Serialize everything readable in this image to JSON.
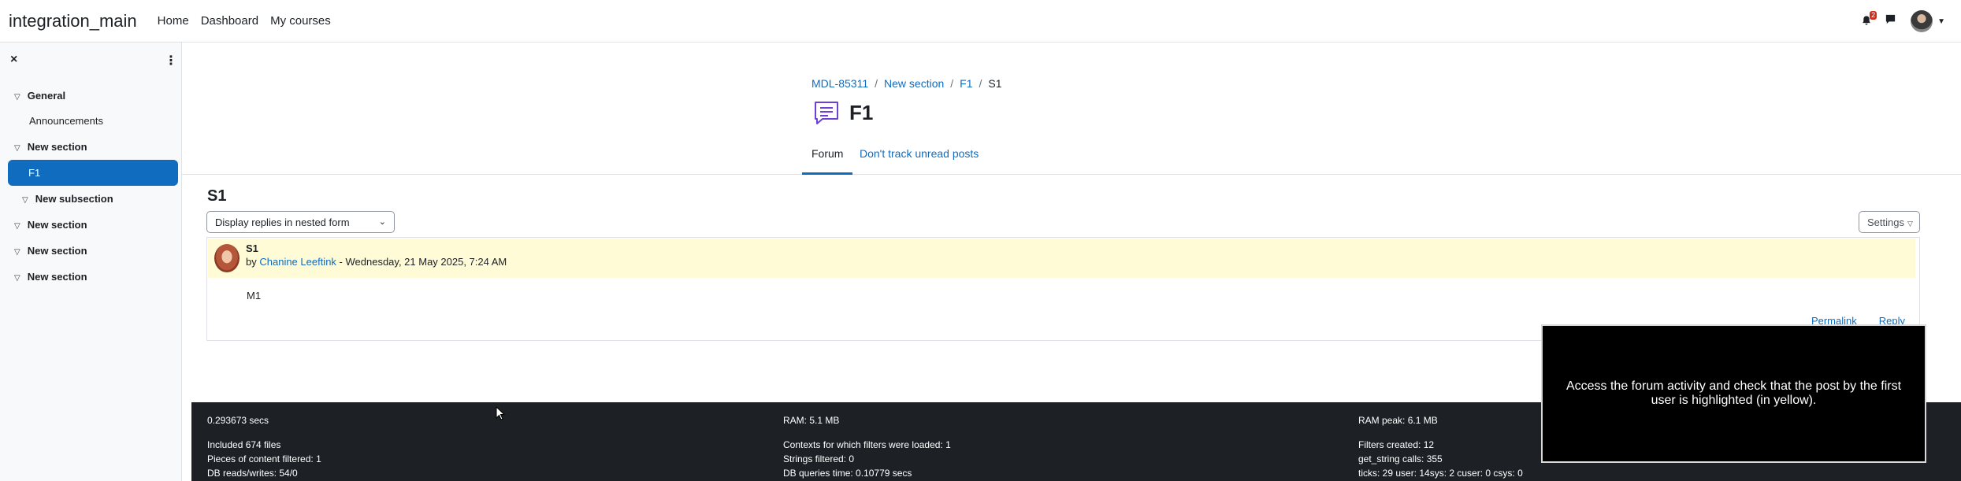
{
  "navbar": {
    "brand": "integration_main",
    "links": [
      "Home",
      "Dashboard",
      "My courses"
    ],
    "notification_count": "2",
    "icons": [
      "bell-icon",
      "chat-icon",
      "avatar",
      "chevron-down-icon"
    ]
  },
  "drawer": {
    "close_icon": "×",
    "menu_icon": "⋮",
    "items": [
      {
        "label": "General",
        "type": "section"
      },
      {
        "label": "Announcements",
        "type": "activity"
      },
      {
        "label": "New section",
        "type": "section"
      },
      {
        "label": "F1",
        "type": "activity",
        "active": true
      },
      {
        "label": "New subsection",
        "type": "subsection"
      },
      {
        "label": "New section",
        "type": "section"
      },
      {
        "label": "New section",
        "type": "section"
      },
      {
        "label": "New section",
        "type": "section"
      }
    ]
  },
  "breadcrumb": [
    {
      "label": "MDL-85311",
      "link": true
    },
    {
      "label": "New section",
      "link": true
    },
    {
      "label": "F1",
      "link": true
    },
    {
      "label": "S1",
      "link": false
    }
  ],
  "page": {
    "title": "F1",
    "tabs": [
      {
        "label": "Forum",
        "active": true
      },
      {
        "label": "Don't track unread posts",
        "active": false
      }
    ],
    "discussion_title": "S1",
    "display_mode": "Display replies in nested form",
    "settings_label": "Settings"
  },
  "post": {
    "subject": "S1",
    "by": "by",
    "author": "Chanine Leeftink",
    "date": " - Wednesday, 21 May 2025, 7:24 AM",
    "body": "M1",
    "actions": [
      "Permalink",
      "Reply"
    ],
    "highlight_color": "#fffbd7"
  },
  "footer": {
    "col1": [
      "0.293673 secs",
      "",
      "Included 674 files",
      "Pieces of content filtered: 1",
      "DB reads/writes: 54/0"
    ],
    "col2": [
      "RAM: 5.1 MB",
      "",
      "Contexts for which filters were loaded: 1",
      "Strings filtered: 0",
      "DB queries time: 0.10779 secs"
    ],
    "col3": [
      "RAM peak: 6.1 MB",
      "",
      "Filters created: 12",
      "get_string calls: 355",
      "ticks: 29 user: 14sys: 2 cuser: 0 csys: 0"
    ]
  },
  "overlay": {
    "text": "Access the forum activity and check that the post by the first user is highlighted (in yellow)."
  },
  "colors": {
    "primary": "#0f6cbf",
    "footer_bg": "#1d2125",
    "drawer_bg": "#f8f9fa"
  }
}
